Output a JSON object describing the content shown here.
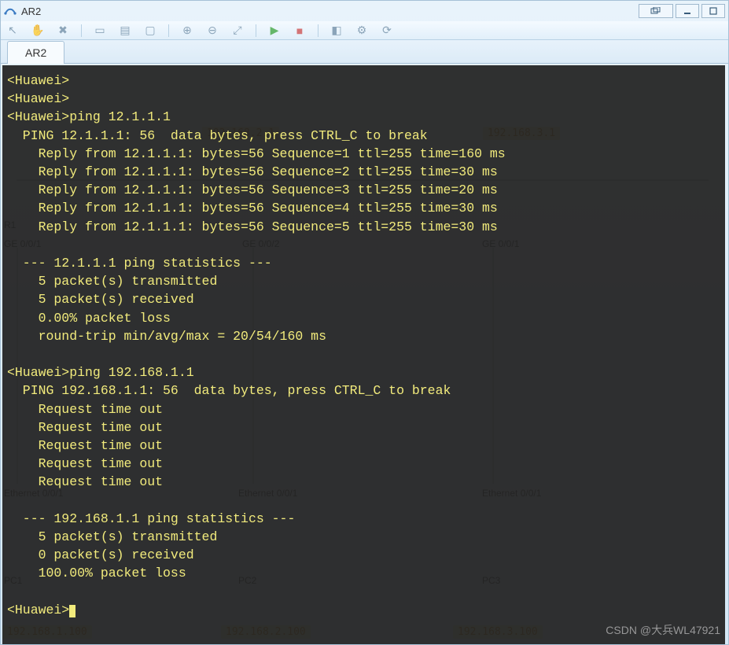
{
  "window": {
    "title": "AR2"
  },
  "tab": {
    "label": "AR2"
  },
  "watermark": "CSDN @大兵WL47921",
  "topology": {
    "ip_top_mid": "192.168.2.1",
    "ip_top_right": "192.168.3.1",
    "r1": "R1",
    "ge001_left": "GE 0/0/1",
    "ge002_mid": "GE 0/0/2",
    "ge_right": "GE 0/0/1",
    "eth_left": "Ethernet 0/0/1",
    "eth_mid": "Ethernet 0/0/1",
    "eth_right": "Ethernet 0/0/1",
    "pc1": "PC1",
    "pc2": "PC2",
    "pc3": "PC3",
    "ip_bot_left": "192.168.1.100",
    "ip_bot_mid": "192.168.2.100",
    "ip_bot_right": "192.168.3.100"
  },
  "terminal": {
    "line01": "<Huawei>",
    "line02": "<Huawei>",
    "line03": "<Huawei>ping 12.1.1.1",
    "line04": "  PING 12.1.1.1: 56  data bytes, press CTRL_C to break",
    "line05": "    Reply from 12.1.1.1: bytes=56 Sequence=1 ttl=255 time=160 ms",
    "line06": "    Reply from 12.1.1.1: bytes=56 Sequence=2 ttl=255 time=30 ms",
    "line07": "    Reply from 12.1.1.1: bytes=56 Sequence=3 ttl=255 time=20 ms",
    "line08": "    Reply from 12.1.1.1: bytes=56 Sequence=4 ttl=255 time=30 ms",
    "line09": "    Reply from 12.1.1.1: bytes=56 Sequence=5 ttl=255 time=30 ms",
    "line10": "",
    "line11": "  --- 12.1.1.1 ping statistics ---",
    "line12": "    5 packet(s) transmitted",
    "line13": "    5 packet(s) received",
    "line14": "    0.00% packet loss",
    "line15": "    round-trip min/avg/max = 20/54/160 ms",
    "line16": "",
    "line17": "<Huawei>ping 192.168.1.1",
    "line18": "  PING 192.168.1.1: 56  data bytes, press CTRL_C to break",
    "line19": "    Request time out",
    "line20": "    Request time out",
    "line21": "    Request time out",
    "line22": "    Request time out",
    "line23": "    Request time out",
    "line24": "",
    "line25": "  --- 192.168.1.1 ping statistics ---",
    "line26": "    5 packet(s) transmitted",
    "line27": "    0 packet(s) received",
    "line28": "    100.00% packet loss",
    "line29": "",
    "line30": "<Huawei>"
  }
}
